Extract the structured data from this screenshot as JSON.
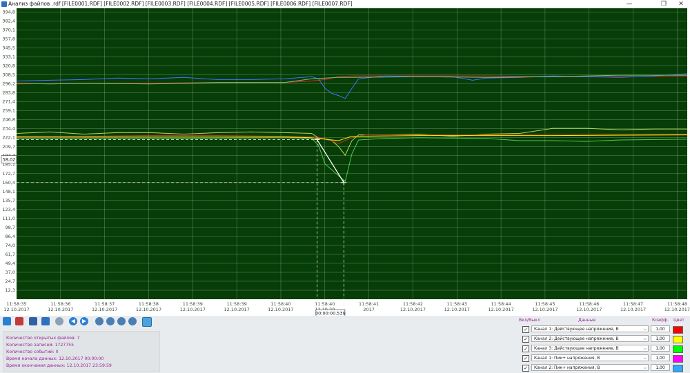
{
  "window": {
    "title": "Анализ файлов .rdf [FILE0001.RDF] [FILE0002.RDF] [FILE0003.RDF] [FILE0004.RDF] [FILE0005.RDF] [FILE0006.RDF] [FILE0007.RDF]",
    "minimize": "—",
    "maximize": "❐",
    "close": "✕"
  },
  "chart_data": {
    "type": "line",
    "background": "#073d07",
    "grid": true,
    "ylim": [
      0,
      400
    ],
    "y_ticks": [
      "394,8",
      "382,4",
      "370,1",
      "357,8",
      "345,5",
      "333,1",
      "320,8",
      "308,5",
      "296,2",
      "283,8",
      "271,4",
      "259,1",
      "246,8",
      "234,4",
      "222,1",
      "209,7",
      "197,4",
      "185,1",
      "172,7",
      "160,4",
      "148,1",
      "135,7",
      "123,4",
      "111,0",
      "98,7",
      "86,4",
      "74,0",
      "61,7",
      "49,4",
      "37,0",
      "24,7",
      "12,3"
    ],
    "x_ticks": [
      {
        "time": "11:58:35",
        "date": "12.10.2017"
      },
      {
        "time": "11:58:36",
        "date": "12.10.2017"
      },
      {
        "time": "11:58:37",
        "date": "12.10.2017"
      },
      {
        "time": "11:58:38",
        "date": "12.10.2017"
      },
      {
        "time": "11:58:39",
        "date": "12.10.2017"
      },
      {
        "time": "11:58:39",
        "date": "12.10.2017"
      },
      {
        "time": "11:58:40",
        "date": "12.10.2017"
      },
      {
        "time": "11:58:40",
        "date": "12.10.20"
      },
      {
        "time": "11:58:41",
        "date": "2017"
      },
      {
        "time": "11:58:42",
        "date": "12.10.2017"
      },
      {
        "time": "11:58:43",
        "date": "12.10.2017"
      },
      {
        "time": "11:58:44",
        "date": "12.10.2017"
      },
      {
        "time": "11:58:45",
        "date": "12.10.2017"
      },
      {
        "time": "11:58:46",
        "date": "12.10.2017"
      },
      {
        "time": "11:58:47",
        "date": "12.10.2017"
      },
      {
        "time": "11:58:48",
        "date": "12.10.2017"
      }
    ],
    "cursor": {
      "delta_y_label": "58,02",
      "delta_t_label": "00:00:00.539",
      "y_from": 219.5,
      "y_to": 160.4
    },
    "series": [
      {
        "color": "#e0281c",
        "values": [
          [
            0,
            296
          ],
          [
            10,
            297
          ],
          [
            20,
            297
          ],
          [
            30,
            298
          ],
          [
            40,
            298
          ],
          [
            44,
            300
          ],
          [
            46,
            302
          ],
          [
            48,
            306
          ],
          [
            50,
            307
          ],
          [
            60,
            307
          ],
          [
            70,
            307
          ],
          [
            80,
            306
          ],
          [
            90,
            306
          ],
          [
            100,
            307
          ]
        ]
      },
      {
        "color": "#3f74ff",
        "values": [
          [
            0,
            300
          ],
          [
            5,
            301
          ],
          [
            10,
            302
          ],
          [
            15,
            304
          ],
          [
            20,
            303
          ],
          [
            25,
            305
          ],
          [
            28,
            303
          ],
          [
            30,
            302
          ],
          [
            35,
            302
          ],
          [
            40,
            303
          ],
          [
            44,
            306
          ],
          [
            45,
            303
          ],
          [
            46,
            290
          ],
          [
            47,
            283
          ],
          [
            48,
            280
          ],
          [
            49,
            276
          ],
          [
            50,
            290
          ],
          [
            51,
            303
          ],
          [
            55,
            307
          ],
          [
            60,
            306
          ],
          [
            65,
            306
          ],
          [
            68,
            301
          ],
          [
            70,
            304
          ],
          [
            75,
            305
          ],
          [
            80,
            307
          ],
          [
            85,
            306
          ],
          [
            90,
            305
          ],
          [
            95,
            307
          ],
          [
            100,
            310
          ]
        ]
      },
      {
        "color": "#7bbf7b",
        "values": [
          [
            0,
            297
          ],
          [
            5,
            296
          ],
          [
            10,
            297
          ],
          [
            20,
            296
          ],
          [
            30,
            298
          ],
          [
            40,
            298
          ],
          [
            44,
            303
          ],
          [
            46,
            304
          ],
          [
            48,
            305
          ],
          [
            50,
            305
          ],
          [
            60,
            306
          ],
          [
            70,
            305
          ],
          [
            80,
            306
          ],
          [
            90,
            308
          ],
          [
            100,
            308
          ]
        ]
      },
      {
        "color": "#b8d45a",
        "values": [
          [
            0,
            228
          ],
          [
            5,
            230
          ],
          [
            10,
            227
          ],
          [
            15,
            229
          ],
          [
            20,
            229
          ],
          [
            25,
            227
          ],
          [
            30,
            229
          ],
          [
            35,
            230
          ],
          [
            40,
            229
          ],
          [
            44,
            228
          ],
          [
            45,
            222
          ],
          [
            47,
            218
          ],
          [
            48,
            210
          ],
          [
            49,
            198
          ],
          [
            50,
            218
          ],
          [
            51,
            226
          ],
          [
            55,
            226
          ],
          [
            60,
            227
          ],
          [
            65,
            224
          ],
          [
            70,
            227
          ],
          [
            75,
            228
          ],
          [
            80,
            235
          ],
          [
            85,
            235
          ],
          [
            90,
            233
          ],
          [
            95,
            234
          ],
          [
            100,
            234
          ]
        ]
      },
      {
        "color": "#c0392b",
        "values": [
          [
            0,
            224
          ],
          [
            10,
            224
          ],
          [
            20,
            225
          ],
          [
            30,
            225
          ],
          [
            40,
            224
          ],
          [
            44,
            224
          ],
          [
            46,
            221
          ],
          [
            48,
            214
          ],
          [
            50,
            222
          ],
          [
            52,
            226
          ],
          [
            60,
            226
          ],
          [
            70,
            226
          ],
          [
            80,
            227
          ],
          [
            90,
            227
          ],
          [
            100,
            227
          ]
        ]
      },
      {
        "color": "#ffee00",
        "values": [
          [
            0,
            223
          ],
          [
            20,
            223
          ],
          [
            40,
            223
          ],
          [
            44,
            222
          ],
          [
            46,
            220
          ],
          [
            48,
            218
          ],
          [
            50,
            224
          ],
          [
            60,
            225
          ],
          [
            80,
            225
          ],
          [
            100,
            226
          ]
        ]
      },
      {
        "color": "#4fc94f",
        "values": [
          [
            0,
            221
          ],
          [
            20,
            221
          ],
          [
            40,
            222
          ],
          [
            44,
            221
          ],
          [
            45,
            212
          ],
          [
            46,
            186
          ],
          [
            47,
            178
          ],
          [
            48,
            170
          ],
          [
            49,
            162
          ],
          [
            50,
            200
          ],
          [
            51,
            219
          ],
          [
            55,
            221
          ],
          [
            60,
            222
          ],
          [
            70,
            221
          ],
          [
            75,
            218
          ],
          [
            80,
            218
          ],
          [
            85,
            217
          ],
          [
            90,
            219
          ],
          [
            100,
            220
          ]
        ]
      }
    ]
  },
  "toolbar": {
    "icons": [
      "open-file-icon",
      "delete-icon",
      "print-icon",
      "save-image-icon",
      "settings-icon",
      "arrow-left-icon",
      "arrow-right-icon",
      "zoom-in-icon",
      "zoom-out-icon",
      "zoom-x-icon",
      "zoom-y-icon",
      "measure-icon"
    ]
  },
  "info": {
    "line1": "Количество открытых файлов: 7",
    "line2": "Количество записей: 1727755",
    "line3": "Количество событий: 0",
    "line4": "Время начала данных: 12.10.2017 00:00:00",
    "line5": "Время окончания данных: 12.10.2017 23:59:59"
  },
  "channels_header": {
    "onoff": "Вкл/Выкл",
    "data": "Данные",
    "coef": "Коэфф.",
    "color": "Цвет"
  },
  "channels": [
    {
      "checked": "✓",
      "label": "Канал 1: Действующее напряжение, В",
      "coef": "1,00",
      "color": "#ff0000"
    },
    {
      "checked": "✓",
      "label": "Канал 2: Действующее напряжение, В",
      "coef": "1,00",
      "color": "#ffff00"
    },
    {
      "checked": "✓",
      "label": "Канал 3: Действующее напряжение, В",
      "coef": "1,00",
      "color": "#00ff00"
    },
    {
      "checked": "✓",
      "label": "Канал 1: Пик+ напряжения, В",
      "coef": "1,00",
      "color": "#ff00ff"
    },
    {
      "checked": "✓",
      "label": "Канал 2: Пик+ напряжения, В",
      "coef": "1,00",
      "color": "#2fa8ff"
    }
  ]
}
